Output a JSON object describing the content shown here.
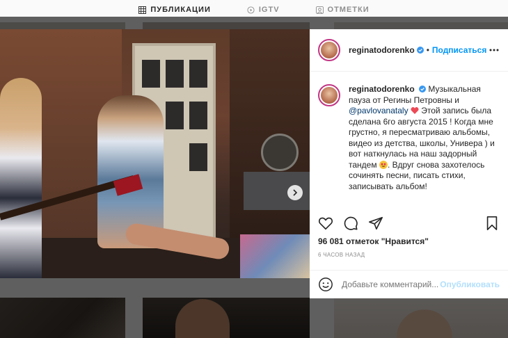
{
  "profile_tabs": [
    {
      "label": "ПУБЛИКАЦИИ",
      "icon": "grid-icon",
      "active": true
    },
    {
      "label": "IGTV",
      "icon": "igtv-icon",
      "active": false
    },
    {
      "label": "ОТМЕТКИ",
      "icon": "tagged-icon",
      "active": false
    }
  ],
  "post": {
    "username": "reginatodorenko",
    "follow_label": "Подписаться",
    "separator": "•",
    "caption": {
      "username": "reginatodorenko",
      "part1": "Музыкальная пауза от Регины Петровны и ",
      "mention": "@pavlovanataly",
      "part2": "Этой запись была сделана 6го августа 2015 ! Когда мне грустно, я пересматриваю альбомы, видео из детства, школы, Универа ) и вот наткнулась на наш задорный тандем",
      "part3": ". Вдруг снова захотелось сочинять песни, писать стихи, записывать альбом!"
    },
    "likes_text": "96 081 отметок \"Нравится\"",
    "time_ago": "6 ЧАСОВ НАЗАД",
    "comment_placeholder": "Добавьте комментарий...",
    "publish_label": "Опубликовать",
    "carousel": {
      "slides": 2,
      "active_index": 0
    },
    "colors": {
      "accent": "#0095f6",
      "verified": "#3897f0",
      "heart": "#ed4956"
    }
  }
}
